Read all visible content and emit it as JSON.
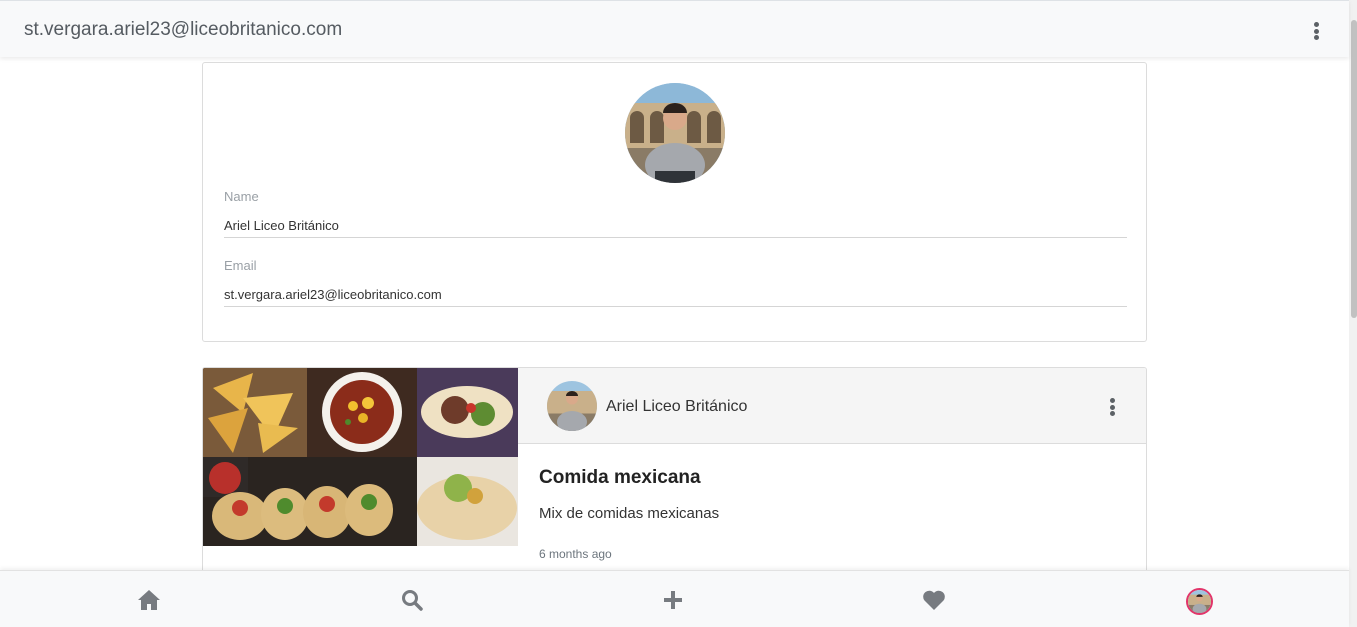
{
  "topbar": {
    "title": "st.vergara.ariel23@liceobritanico.com",
    "menu_icon": "kebab-menu-icon"
  },
  "profile": {
    "avatar_icon": "user-avatar",
    "name_label": "Name",
    "name_value": "Ariel Liceo Británico",
    "email_label": "Email",
    "email_value": "st.vergara.ariel23@liceobritanico.com"
  },
  "post": {
    "image_icon": "mexican-food-collage",
    "author": "Ariel Liceo Británico",
    "title": "Comida mexicana",
    "description": "Mix de comidas mexicanas",
    "time": "6 months ago"
  },
  "bottomnav": {
    "items": [
      {
        "icon": "home-icon"
      },
      {
        "icon": "search-icon"
      },
      {
        "icon": "plus-icon"
      },
      {
        "icon": "heart-icon"
      },
      {
        "icon": "profile-avatar"
      }
    ]
  },
  "colors": {
    "icon_gray": "#777b80",
    "avatar_ring": "#e2356a"
  }
}
